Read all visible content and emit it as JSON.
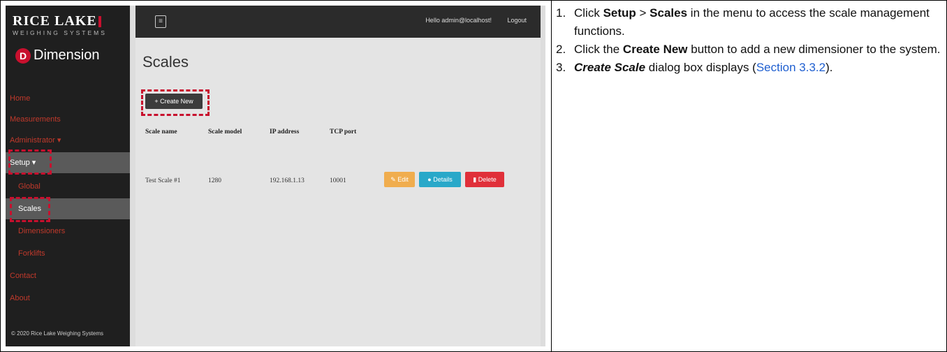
{
  "screenshot": {
    "brand": {
      "company_top": "RICE LAKE",
      "company_sub": "WEIGHING SYSTEMS",
      "product": "Dimension",
      "product_icon": "D"
    },
    "nav": [
      {
        "label": "Home"
      },
      {
        "label": "Measurements"
      },
      {
        "label": "Administrator ▾"
      },
      {
        "label": "Setup ▾"
      },
      {
        "label": "Global"
      },
      {
        "label": "Scales"
      },
      {
        "label": "Dimensioners"
      },
      {
        "label": "Forklifts"
      },
      {
        "label": "Contact"
      },
      {
        "label": "About"
      }
    ],
    "copyright": "© 2020 Rice Lake Weighing Systems",
    "topbar": {
      "menu_icon": "≡",
      "greeting": "Hello admin@localhost!",
      "logout": "Logout"
    },
    "page_title": "Scales",
    "create_button": "+ Create New",
    "table": {
      "headers": [
        "Scale name",
        "Scale model",
        "IP address",
        "TCP port"
      ],
      "rows": [
        {
          "name": "Test Scale #1",
          "model": "1280",
          "ip": "192.168.1.13",
          "port": "10001"
        }
      ],
      "actions": {
        "edit": "✎ Edit",
        "details": "● Details",
        "delete": "▮ Delete"
      }
    },
    "colors": {
      "accent_red": "#c8102e",
      "edit": "#f0ad4e",
      "details": "#29a8c9",
      "delete": "#e0303a"
    }
  },
  "instructions": {
    "step1": {
      "num": "1.",
      "pre": "Click ",
      "b1": "Setup",
      "mid": " > ",
      "b2": "Scales",
      "post": " in the menu to access the scale management functions."
    },
    "step2": {
      "num": "2.",
      "pre": "Click the ",
      "b1": "Create New",
      "post": " button to add a new dimensioner to the system."
    },
    "step3": {
      "num": "3.",
      "bi": "Create Scale",
      "mid": " dialog box displays (",
      "link": "Section 3.3.2",
      "post": ")."
    }
  }
}
